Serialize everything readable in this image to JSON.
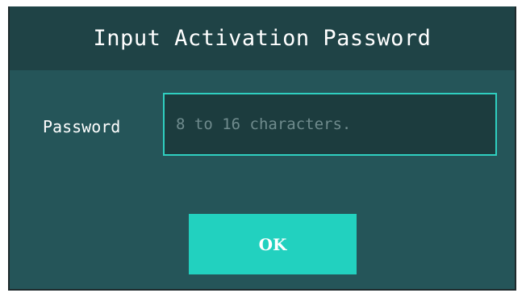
{
  "dialog": {
    "title": "Input Activation Password",
    "password_label": "Password",
    "password_value": "",
    "password_placeholder": "8 to 16 characters.",
    "ok_label": "OK"
  },
  "colors": {
    "dialog_bg": "#255559",
    "title_bar_bg": "#1f4346",
    "input_bg": "#1c3c3e",
    "input_border": "#2fcfc0",
    "ok_button_bg": "#22d1bf",
    "text": "#ffffff",
    "placeholder": "#6f8b8d"
  }
}
